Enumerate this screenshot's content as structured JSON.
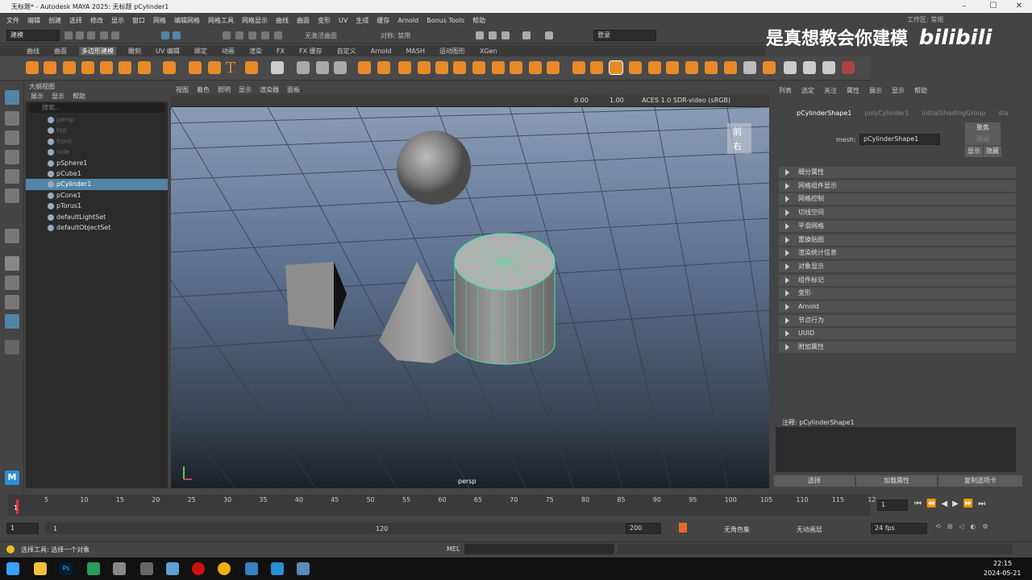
{
  "titlebar": {
    "title": "无标题* - Autodesk MAYA 2025: 无标题   pCylinder1"
  },
  "menubar": {
    "items": [
      "文件",
      "编辑",
      "创建",
      "选择",
      "修改",
      "显示",
      "窗口",
      "网格",
      "编辑网格",
      "网格工具",
      "网格显示",
      "曲线",
      "曲面",
      "变形",
      "UV",
      "生成",
      "缓存",
      "Arnold",
      "Bonus Tools",
      "帮助"
    ]
  },
  "status": {
    "mode": "建模",
    "live": "无激活曲面",
    "sym": "对称: 禁用",
    "login": "登录",
    "workspace": "工作区: 常规"
  },
  "shelf": {
    "tabs": [
      "曲线",
      "曲面",
      "多边形建模",
      "雕刻",
      "UV 编辑",
      "绑定",
      "动画",
      "渲染",
      "FX",
      "FX 缓存",
      "自定义",
      "Arnold",
      "MASH",
      "运动图形",
      "XGen"
    ],
    "active": 2
  },
  "watermark": "是真想教会你建模",
  "outliner": {
    "title": "大纲视图",
    "menu": [
      "展示",
      "显示",
      "帮助"
    ],
    "search": "搜索...",
    "items": [
      "persp",
      "top",
      "front",
      "side",
      "pSphere1",
      "pCube1",
      "pCylinder1",
      "pCone1",
      "pTorus1",
      "defaultLightSet",
      "defaultObjectSet"
    ],
    "selected": "pCylinder1"
  },
  "viewport": {
    "menu": [
      "视图",
      "着色",
      "照明",
      "显示",
      "渲染器",
      "面板"
    ],
    "exposure": "0.00",
    "gamma": "1.00",
    "colorspace": "ACES 1.0 SDR-video (sRGB)",
    "camera": "persp",
    "cube_front": "前",
    "cube_right": "右"
  },
  "attr": {
    "menu": [
      "列表",
      "选定",
      "关注",
      "属性",
      "展示",
      "显示",
      "帮助"
    ],
    "tabs": [
      "pCylinderShape1",
      "polyCylinder1",
      "initialShadingGroup",
      "sta"
    ],
    "mesh_label": "mesh:",
    "mesh_value": "pCylinderShape1",
    "focus": "聚焦",
    "preset": "预设",
    "show": "显示",
    "hide": "隐藏",
    "sections": [
      "细分属性",
      "网格组件显示",
      "网格控制",
      "切线空间",
      "平滑网格",
      "置换贴图",
      "渲染统计信息",
      "对象显示",
      "组件标记",
      "变形",
      "Arnold",
      "节点行为",
      "UUID",
      "附加属性"
    ],
    "notes": "注释:  pCylinderShape1",
    "buttons": [
      "选择",
      "加载属性",
      "复制选项卡"
    ]
  },
  "timeline": {
    "ticks": [
      "5",
      "10",
      "15",
      "20",
      "25",
      "30",
      "35",
      "40",
      "45",
      "50",
      "55",
      "60",
      "65",
      "70",
      "75",
      "80",
      "85",
      "90",
      "95",
      "100",
      "105",
      "110",
      "115",
      "12"
    ],
    "current": "1",
    "field": "1"
  },
  "range": {
    "start": "1",
    "inner_start": "1",
    "inner_end": "120",
    "end": "200",
    "charset": "无角色集",
    "anim_layer": "无动画层",
    "fps": "24 fps"
  },
  "cmd": {
    "help": "选择工具: 选择一个对象",
    "lang": "MEL"
  },
  "taskbar": {
    "time": "22:15",
    "date": "2024-05-21"
  }
}
